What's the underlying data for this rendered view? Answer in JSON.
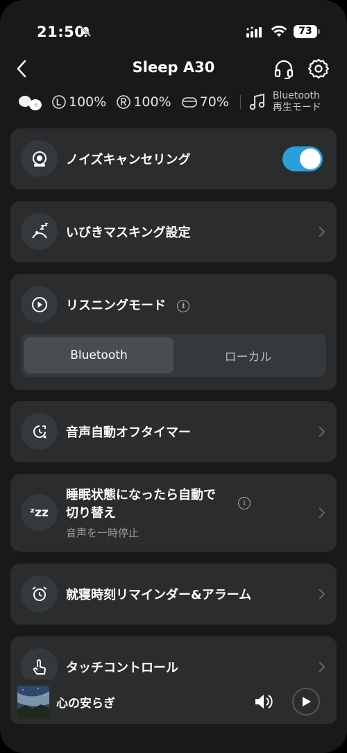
{
  "status_bar": {
    "time": "21:50",
    "battery": "73"
  },
  "header": {
    "title": "Sleep A30"
  },
  "device_status": {
    "left_battery": "100%",
    "right_battery": "100%",
    "case_battery": "70%",
    "mode_line1": "Bluetooth",
    "mode_line2": "再生モード"
  },
  "settings": {
    "noise_cancel": {
      "label": "ノイズキャンセリング",
      "enabled": true
    },
    "snore_masking": {
      "label": "いびきマスキング設定"
    },
    "listening_mode": {
      "label": "リスニングモード",
      "options": [
        "Bluetooth",
        "ローカル"
      ],
      "selected": "Bluetooth"
    },
    "audio_timer": {
      "label": "音声自動オフタイマー"
    },
    "sleep_switch": {
      "label_line1": "睡眠状態になったら自動で",
      "label_line2": "切り替え",
      "sublabel": "音声を一時停止"
    },
    "bedtime_reminder": {
      "label": "就寝時刻リマインダー&アラーム"
    },
    "touch_control": {
      "label": "タッチコントロール"
    }
  },
  "player": {
    "title": "心の安らぎ"
  },
  "colors": {
    "accent": "#2a9fdb",
    "card_bg": "#2a2c2e",
    "background": "#17191a"
  }
}
